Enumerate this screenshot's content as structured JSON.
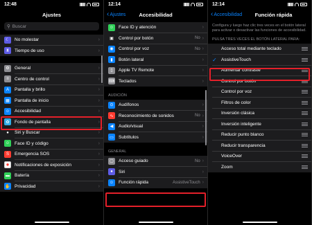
{
  "panel1": {
    "time": "12:48",
    "title": "Ajustes",
    "search_placeholder": "Buscar",
    "group1": [
      {
        "label": "No molestar",
        "icon": "moon-icon",
        "color": "#5e5ce6"
      },
      {
        "label": "Tiempo de uso",
        "icon": "hourglass-icon",
        "color": "#5e5ce6"
      }
    ],
    "group2": [
      {
        "label": "General",
        "icon": "gear-icon",
        "color": "#8e8e93"
      },
      {
        "label": "Centro de control",
        "icon": "switches-icon",
        "color": "#8e8e93"
      },
      {
        "label": "Pantalla y brillo",
        "icon": "text-size-icon",
        "color": "#0a84ff"
      },
      {
        "label": "Pantalla de inicio",
        "icon": "grid-icon",
        "color": "#0a84ff"
      },
      {
        "label": "Accesibilidad",
        "icon": "accessibility-icon",
        "color": "#0a84ff"
      },
      {
        "label": "Fondo de pantalla",
        "icon": "flower-icon",
        "color": "#32ade6"
      },
      {
        "label": "Siri y Buscar",
        "icon": "siri-icon",
        "color": "#1c1c1e"
      },
      {
        "label": "Face ID y código",
        "icon": "face-id-icon",
        "color": "#30d158"
      },
      {
        "label": "Emergencia SOS",
        "icon": "sos-icon",
        "color": "#ff3b30"
      },
      {
        "label": "Notificaciones de exposición",
        "icon": "virus-icon",
        "color": "#ffffff"
      },
      {
        "label": "Batería",
        "icon": "battery-icon",
        "color": "#30d158"
      },
      {
        "label": "Privacidad",
        "icon": "hand-icon",
        "color": "#0a84ff"
      }
    ]
  },
  "panel2": {
    "time": "12:14",
    "back": "Ajustes",
    "title": "Accesibilidad",
    "group1": [
      {
        "label": "Face ID y atención",
        "value": "",
        "icon": "face-id-icon",
        "color": "#30d158"
      },
      {
        "label": "Control por botón",
        "value": "No",
        "icon": "switch-control-icon",
        "color": "#1c1c1e"
      },
      {
        "label": "Control por voz",
        "value": "No",
        "icon": "voice-control-icon",
        "color": "#0a84ff"
      },
      {
        "label": "Botón lateral",
        "value": "",
        "icon": "side-button-icon",
        "color": "#0a84ff"
      },
      {
        "label": "Apple TV Remote",
        "value": "",
        "icon": "remote-icon",
        "color": "#8e8e93"
      },
      {
        "label": "Teclados",
        "value": "",
        "icon": "keyboard-icon",
        "color": "#8e8e93"
      }
    ],
    "section_audio": "AUDICIÓN",
    "group2": [
      {
        "label": "Audífonos",
        "value": "",
        "icon": "ear-icon",
        "color": "#0a84ff"
      },
      {
        "label": "Reconocimiento de sonidos",
        "value": "No",
        "icon": "waveform-icon",
        "color": "#ff3b30"
      },
      {
        "label": "Audio/visual",
        "value": "",
        "icon": "speaker-icon",
        "color": "#0a84ff"
      },
      {
        "label": "Subtítulos",
        "value": "",
        "icon": "captions-icon",
        "color": "#0a84ff"
      }
    ],
    "section_general": "GENERAL",
    "group3": [
      {
        "label": "Acceso guiado",
        "value": "No",
        "icon": "lock-icon",
        "color": "#8e8e93"
      },
      {
        "label": "Siri",
        "value": "",
        "icon": "siri-icon",
        "color": "#5e5ce6"
      },
      {
        "label": "Función rápida",
        "value": "AssistiveTouch",
        "icon": "accessibility-icon",
        "color": "#0a84ff"
      }
    ]
  },
  "panel3": {
    "time": "12:14",
    "back": "Accesibilidad",
    "title": "Función rápida",
    "description": "Configura y luego haz clic tres veces en el botón lateral para activar o desactivar las funciones de accesibilidad.",
    "section": "PULSA TRES VECES EL BOTÓN LATERAL PARA:",
    "options": [
      {
        "label": "Acceso total mediante teclado",
        "checked": false
      },
      {
        "label": "AssistiveTouch",
        "checked": true
      },
      {
        "label": "Aumentar contraste",
        "checked": false
      },
      {
        "label": "Control por botón",
        "checked": false
      },
      {
        "label": "Control por voz",
        "checked": false
      },
      {
        "label": "Filtros de color",
        "checked": false
      },
      {
        "label": "Inversión clásica",
        "checked": false
      },
      {
        "label": "Inversión inteligente",
        "checked": false
      },
      {
        "label": "Reducir punto blanco",
        "checked": false
      },
      {
        "label": "Reducir transparencia",
        "checked": false
      },
      {
        "label": "VoiceOver",
        "checked": false
      },
      {
        "label": "Zoom",
        "checked": false
      }
    ]
  },
  "colors": {
    "highlight": "#e5202a",
    "accent": "#0a84ff"
  }
}
